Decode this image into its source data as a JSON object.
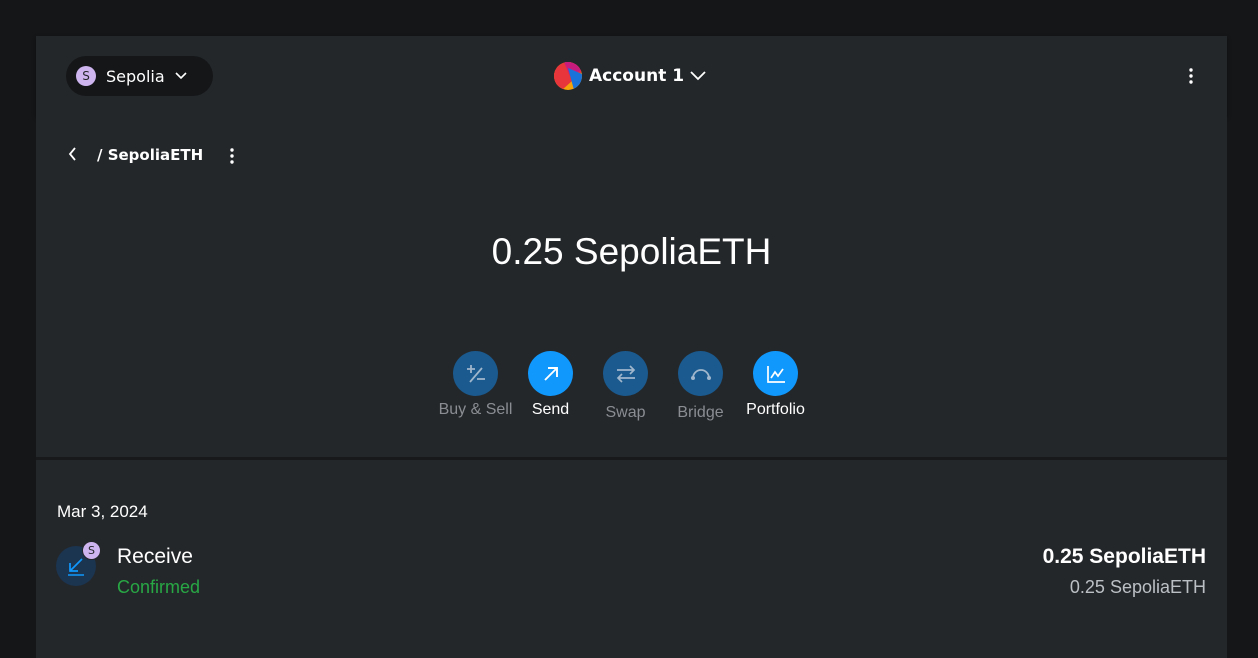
{
  "header": {
    "network": {
      "label": "Sepolia",
      "avatar_letter": "S"
    },
    "account": {
      "label": "Account 1"
    }
  },
  "asset": {
    "breadcrumb": "/ SepoliaETH",
    "balance": "0.25 SepoliaETH"
  },
  "actions": [
    {
      "label": "Buy & Sell",
      "icon": "plus-minus-icon",
      "enabled": false
    },
    {
      "label": "Send",
      "icon": "arrow-up-right-icon",
      "enabled": true
    },
    {
      "label": "Swap",
      "icon": "swap-arrows-icon",
      "enabled": false
    },
    {
      "label": "Bridge",
      "icon": "bridge-icon",
      "enabled": false
    },
    {
      "label": "Portfolio",
      "icon": "chart-icon",
      "enabled": true
    }
  ],
  "activity": {
    "date": "Mar 3, 2024",
    "transactions": [
      {
        "title": "Receive",
        "status": "Confirmed",
        "amount": "0.25 SepoliaETH",
        "secondary_amount": "0.25 SepoliaETH",
        "badge_letter": "S"
      }
    ]
  },
  "colors": {
    "accent": "#1098fc",
    "accent_disabled": "#1a5a8e",
    "success": "#28a745",
    "background": "#24272a",
    "outer_background": "#141618",
    "network_avatar": "#cfb5f0"
  }
}
